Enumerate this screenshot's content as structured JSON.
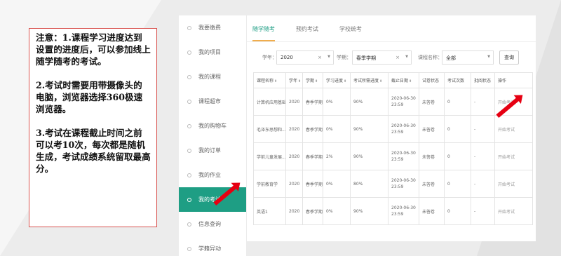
{
  "note": {
    "paragraphs": [
      "注意：1.课程学习进度达到设置的进度后，可以参加线上随学随考的考试。",
      "2.考试时需要用带摄像头的电脑，浏览器选择360极速浏览器。",
      "3.考试在课程截止时间之前可以考10次，每次都是随机生成，考试成绩系统留取最高分。"
    ]
  },
  "sidebar": {
    "items": [
      {
        "label": "我要缴费",
        "active": false
      },
      {
        "label": "我的项目",
        "active": false
      },
      {
        "label": "我的课程",
        "active": false
      },
      {
        "label": "课程超市",
        "active": false
      },
      {
        "label": "我的购物车",
        "active": false
      },
      {
        "label": "我的订单",
        "active": false
      },
      {
        "label": "我的作业",
        "active": false
      },
      {
        "label": "我的考试",
        "active": true
      },
      {
        "label": "信息查询",
        "active": false
      },
      {
        "label": "学籍异动",
        "active": false
      }
    ]
  },
  "tabs": [
    {
      "label": "随学随考",
      "active": true
    },
    {
      "label": "预约考试",
      "active": false
    },
    {
      "label": "学校统考",
      "active": false
    }
  ],
  "filters": {
    "year_label": "学年：",
    "year_value": "2020",
    "term_label": "学期：",
    "term_value": "春季学期",
    "course_label": "课程名称：",
    "course_value": "全部",
    "clear_symbol": "×",
    "caret_symbol": "▼",
    "query_label": "查询"
  },
  "table": {
    "headers": [
      "课程名称",
      "学年",
      "学期",
      "学习进度",
      "考试所需进度",
      "截止日期",
      "试卷状态",
      "考试次数",
      "批阅状态",
      "操作"
    ],
    "sort_symbol": "⬍",
    "rows": [
      {
        "course": "计算机应用基础",
        "year": "2020",
        "term": "春季学期",
        "progress": "0%",
        "required": "90%",
        "deadline_date": "2020-06-30",
        "deadline_time": "23:59",
        "paper_status": "未答卷",
        "attempts": "0",
        "review": "-",
        "action": "开始考试"
      },
      {
        "course": "毛泽东思想和...",
        "year": "2020",
        "term": "春季学期",
        "progress": "0%",
        "required": "90%",
        "deadline_date": "2020-06-30",
        "deadline_time": "23:59",
        "paper_status": "未答卷",
        "attempts": "0",
        "review": "-",
        "action": "开始考试"
      },
      {
        "course": "学前儿童发展...",
        "year": "2020",
        "term": "春季学期",
        "progress": "2%",
        "required": "90%",
        "deadline_date": "2020-06-30",
        "deadline_time": "23:59",
        "paper_status": "未答卷",
        "attempts": "0",
        "review": "-",
        "action": "开始考试"
      },
      {
        "course": "学前教育学",
        "year": "2020",
        "term": "春季学期",
        "progress": "0%",
        "required": "80%",
        "deadline_date": "2020-06-30",
        "deadline_time": "23:59",
        "paper_status": "未答卷",
        "attempts": "0",
        "review": "-",
        "action": "开始考试"
      },
      {
        "course": "英语1",
        "year": "2020",
        "term": "春季学期",
        "progress": "0%",
        "required": "90%",
        "deadline_date": "2020-06-30",
        "deadline_time": "23:59",
        "paper_status": "未答卷",
        "attempts": "0",
        "review": "-",
        "action": "开始考试"
      }
    ]
  },
  "colors": {
    "accent": "#1e9e84",
    "tab_underline": "#f0ad4e",
    "note_border": "#d9534f",
    "arrow": "#e60012"
  }
}
